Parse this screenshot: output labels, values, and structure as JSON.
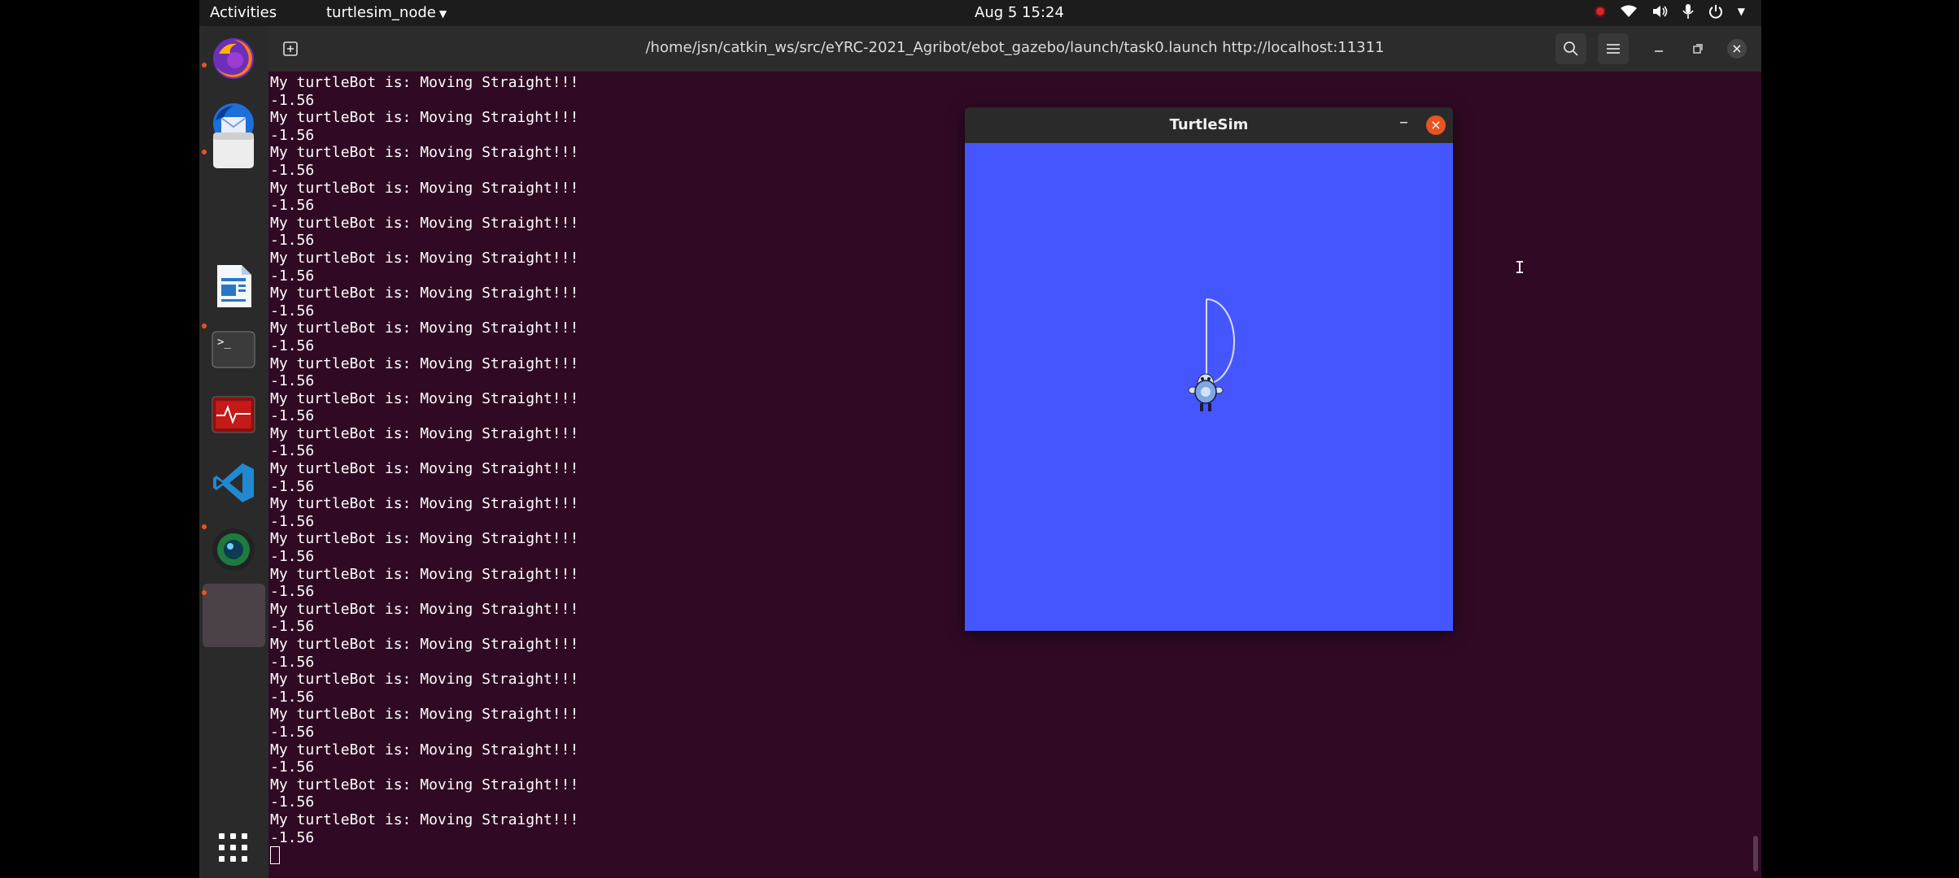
{
  "topbar": {
    "activities": "Activities",
    "app_menu": "turtlesim_node",
    "clock": "Aug 5  15:24"
  },
  "dock": {
    "items": [
      {
        "icon": "firefox-icon",
        "running": true
      },
      {
        "icon": "thunderbird-icon",
        "running": false
      },
      {
        "icon": "files-icon",
        "running": true
      },
      {
        "icon": "libreoffice-writer-icon",
        "running": false
      },
      {
        "icon": "terminal-icon",
        "running": true
      },
      {
        "icon": "system-monitor-icon",
        "running": false
      },
      {
        "icon": "vscode-icon",
        "running": false
      },
      {
        "icon": "camera-icon",
        "running": true
      },
      {
        "icon": "active-window-icon",
        "running": true
      },
      {
        "icon": "show-applications-icon",
        "running": false
      }
    ]
  },
  "terminal": {
    "title": "/home/jsn/catkin_ws/src/eYRC-2021_Agribot/ebot_gazebo/launch/task0.launch http://localhost:11311",
    "message": "My turtleBot is: Moving Straight!!!",
    "value": "-1.56",
    "repeat_count": 22
  },
  "turtlesim": {
    "title": "TurtleSim",
    "minimize_label": "–",
    "close_label": "×",
    "background": "#4556ff"
  }
}
